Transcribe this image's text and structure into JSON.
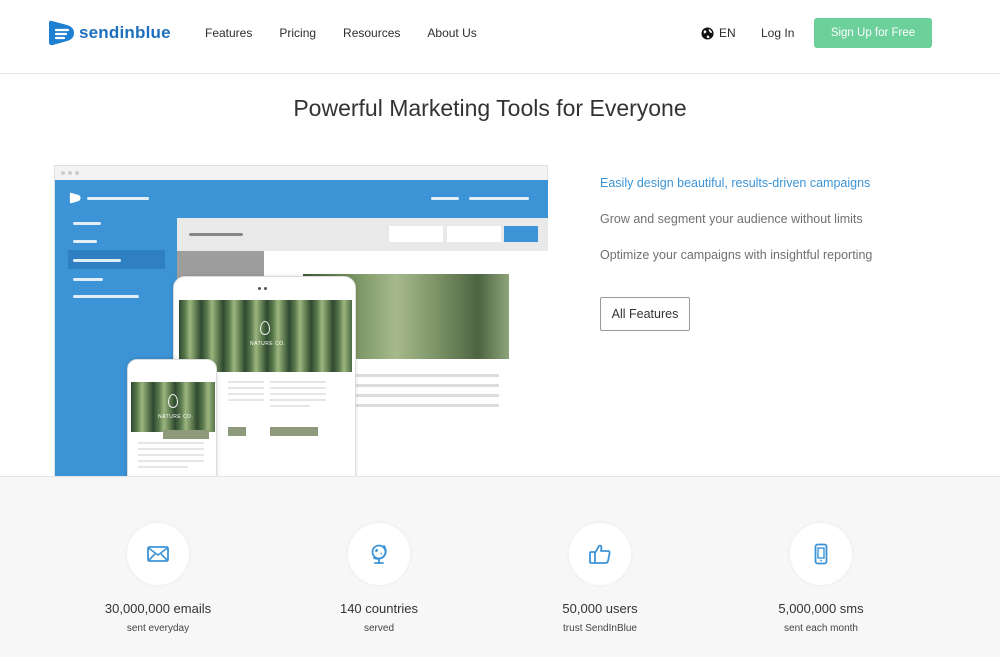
{
  "header": {
    "logo_text": "sendinblue",
    "nav": [
      "Features",
      "Pricing",
      "Resources",
      "About Us"
    ],
    "lang": "EN",
    "login": "Log In",
    "signup": "Sign Up for Free"
  },
  "hero": {
    "title": "Powerful Marketing Tools for Everyone",
    "features": [
      "Easily design beautiful, results-driven campaigns",
      "Grow and segment your audience without limits",
      "Optimize your campaigns with insightful reporting"
    ],
    "all_features": "All Features"
  },
  "mockup": {
    "brand_label": "NATURE CO."
  },
  "stats": [
    {
      "icon": "envelope-icon",
      "number": "30,000,000 emails",
      "sub": "sent everyday"
    },
    {
      "icon": "globe-icon",
      "number": "140 countries",
      "sub": "served"
    },
    {
      "icon": "thumbs-up-icon",
      "number": "50,000 users",
      "sub": "trust SendInBlue"
    },
    {
      "icon": "mobile-phone-icon",
      "number": "5,000,000 sms",
      "sub": "sent each month"
    }
  ],
  "colors": {
    "accent_blue": "#3c94d6",
    "signup_green": "#6bd09a",
    "stats_bg": "#f7f7f7"
  }
}
